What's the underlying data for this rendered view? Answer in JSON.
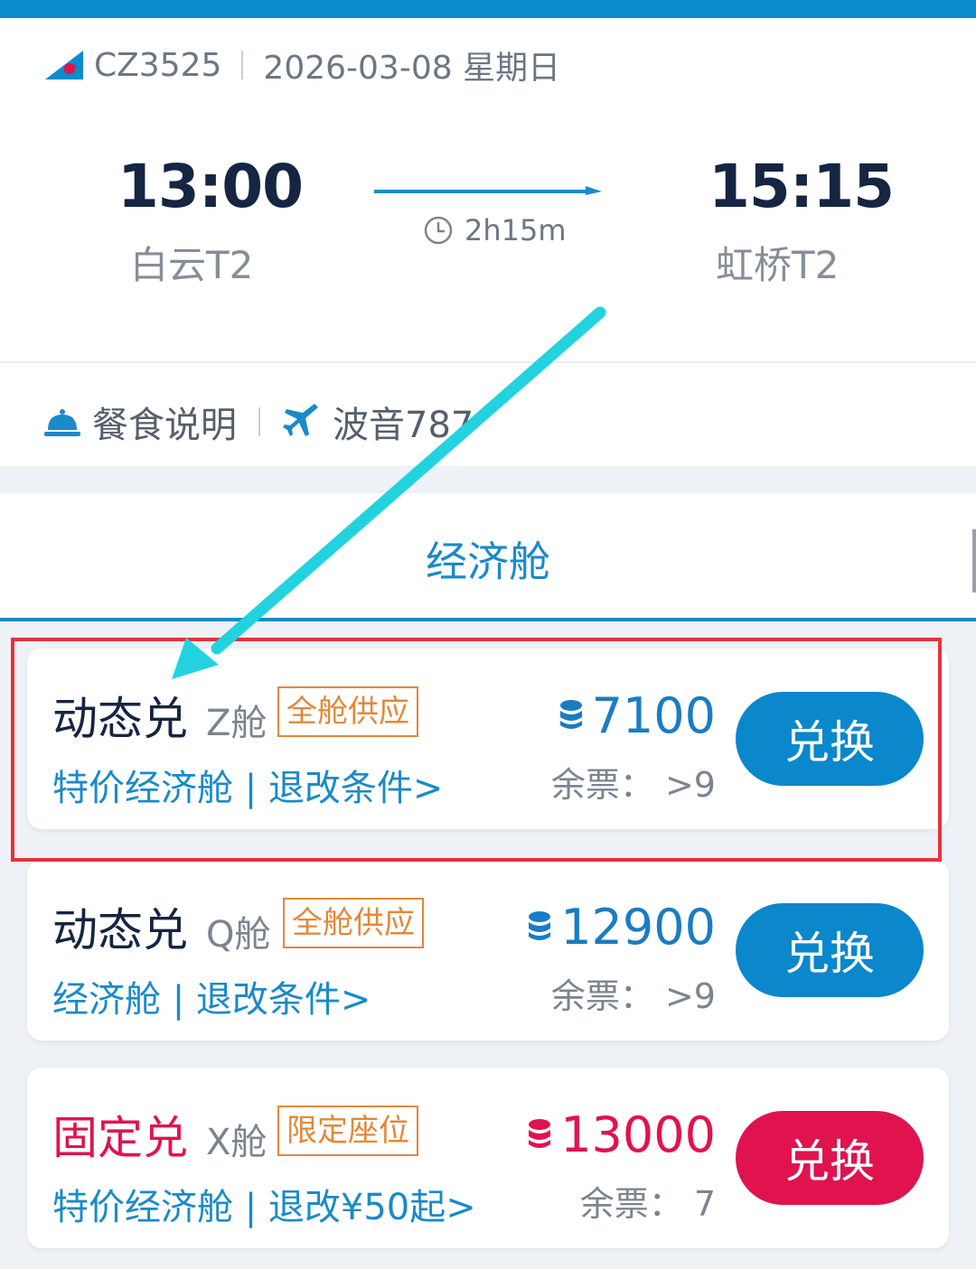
{
  "flight": {
    "number": "CZ3525",
    "date": "2026-03-08 星期日",
    "departure": {
      "time": "13:00",
      "airport": "白云T2"
    },
    "arrival": {
      "time": "15:15",
      "airport": "虹桥T2"
    },
    "duration": "2h15m"
  },
  "info": {
    "meal_label": "餐食说明",
    "aircraft_label": "波音787"
  },
  "tabs": {
    "active_label": "经济舱"
  },
  "fares": [
    {
      "name": "动态兑",
      "cabin": "Z舱",
      "badge": "全舱供应",
      "subtype": "特价经济舱",
      "rules_link": "退改条件>",
      "price": "7100",
      "remaining": "余票：  >9",
      "button": "兑换",
      "color": "#0b87cc"
    },
    {
      "name": "动态兑",
      "cabin": "Q舱",
      "badge": "全舱供应",
      "subtype": "经济舱",
      "rules_link": "退改条件>",
      "price": "12900",
      "remaining": "余票：  >9",
      "button": "兑换",
      "color": "#0b87cc"
    },
    {
      "name": "固定兑",
      "cabin": "X舱",
      "badge": "限定座位",
      "subtype": "特价经济舱",
      "rules_link": "退改¥50起>",
      "price": "13000",
      "remaining": "余票：  7",
      "button": "兑换",
      "color": "#e0134f"
    }
  ],
  "colors": {
    "brand_blue": "#0b87cc",
    "accent_red": "#e0134f",
    "badge_orange": "#e3883a",
    "highlight_red": "#e8313a",
    "annotation_cyan": "#22d3df"
  }
}
